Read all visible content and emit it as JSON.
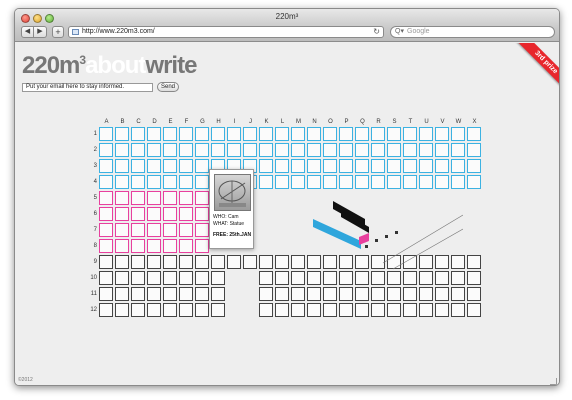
{
  "window": {
    "title": "220m³"
  },
  "toolbar": {
    "back_label": "◀",
    "forward_label": "▶",
    "add_label": "+",
    "url": "http://www.220m3.com/",
    "reload_label": "↻",
    "search_placeholder": "Google",
    "search_icon_label": "Q▾"
  },
  "logo": {
    "part1": "220m",
    "part1_sup": "3",
    "part2": "about",
    "part3": "write"
  },
  "signup": {
    "placeholder": "Put your email here to stay informed.",
    "send_label": "Send"
  },
  "badge": {
    "label": "3rd prize"
  },
  "grid": {
    "columns": [
      "A",
      "B",
      "C",
      "D",
      "E",
      "F",
      "G",
      "H",
      "I",
      "J",
      "K",
      "L",
      "M",
      "N",
      "O",
      "P",
      "Q",
      "R",
      "S",
      "T",
      "U",
      "V",
      "W",
      "X"
    ],
    "rows": [
      "1",
      "2",
      "3",
      "4",
      "5",
      "6",
      "7",
      "8",
      "9",
      "10",
      "11",
      "12"
    ],
    "colors": {
      "blue": "#3cb2e2",
      "pink": "#e8409e",
      "black": "#444444"
    }
  },
  "popup": {
    "who": "WHO: Cam",
    "what": "WHAT: Statue",
    "free": "FREE: 25th.JAN"
  },
  "footer": {
    "copyright": "©2012"
  }
}
